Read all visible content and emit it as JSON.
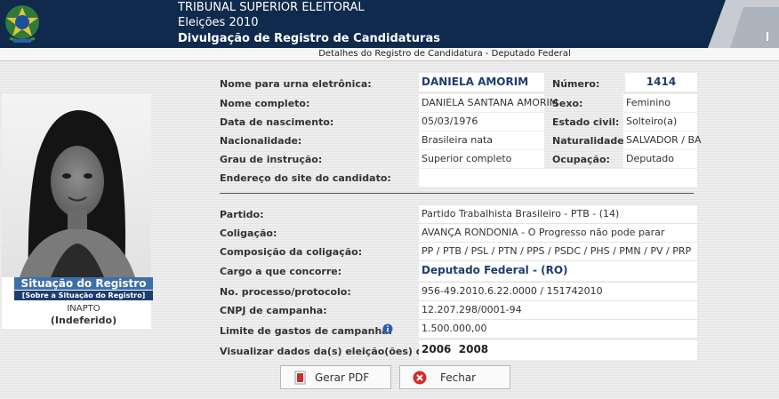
{
  "header": {
    "line1": "TRIBUNAL SUPERIOR ELEITORAL",
    "line2": "Eleições 2010",
    "line3": "Divulgação de Registro de Candidaturas"
  },
  "subtitle": "Detalhes do Registro de Candidatura - Deputado Federal",
  "situacao": {
    "title": "Situação do Registro",
    "link": "[Sobre a Situação do Registro]",
    "status": "INAPTO",
    "detail": "(Indeferido)"
  },
  "fields": {
    "nome_urna_label": "Nome para urna eletrônica:",
    "nome_urna": "DANIELA AMORIM",
    "numero_label": "Número:",
    "numero": "1414",
    "nome_completo_label": "Nome completo:",
    "nome_completo": "DANIELA SANTANA AMORIM",
    "sexo_label": "Sexo:",
    "sexo": "Feminino",
    "nascimento_label": "Data de nascimento:",
    "nascimento": "05/03/1976",
    "estado_civil_label": "Estado civil:",
    "estado_civil": "Solteiro(a)",
    "nacionalidade_label": "Nacionalidade:",
    "nacionalidade": "Brasileira nata",
    "naturalidade_label": "Naturalidade:",
    "naturalidade": "SALVADOR / BA",
    "grau_label": "Grau de instrução:",
    "grau": "Superior completo",
    "ocupacao_label": "Ocupação:",
    "ocupacao": "Deputado",
    "site_label": "Endereço do site do candidato:",
    "site": "",
    "partido_label": "Partido:",
    "partido": "Partido Trabalhista Brasileiro - PTB - (14)",
    "coligacao_label": "Coligação:",
    "coligacao": "AVANÇA RONDONIA - O Progresso não pode parar",
    "composicao_label": "Composição da coligação:",
    "composicao": "PP / PTB / PSL / PTN / PPS / PSDC / PHS / PMN / PV / PRP",
    "cargo_label": "Cargo a que concorre:",
    "cargo": "Deputado Federal - (RO)",
    "processo_label": "No. processo/protocolo:",
    "processo": "956-49.2010.6.22.0000 / 151742010",
    "cnpj_label": "CNPJ de campanha:",
    "cnpj": "12.207.298/0001-94",
    "limite_label": "Limite de gastos de campanha:",
    "limite": "1.500.000,00",
    "visualizar_label": "Visualizar dados da(s) eleição(ões) de:",
    "eleicoes": "2006  2008"
  },
  "buttons": {
    "pdf": "Gerar PDF",
    "fechar": "Fechar"
  },
  "icons": {
    "emblem": "brazil-coat-of-arms-icon",
    "info": "info-icon",
    "pdf": "pdf-icon",
    "close": "close-icon"
  },
  "colors": {
    "header_bg": "#0f2a4d",
    "situacao_bg": "#3d6fa8",
    "accent_text": "#1c3d6e",
    "close_red": "#d42a2a"
  }
}
